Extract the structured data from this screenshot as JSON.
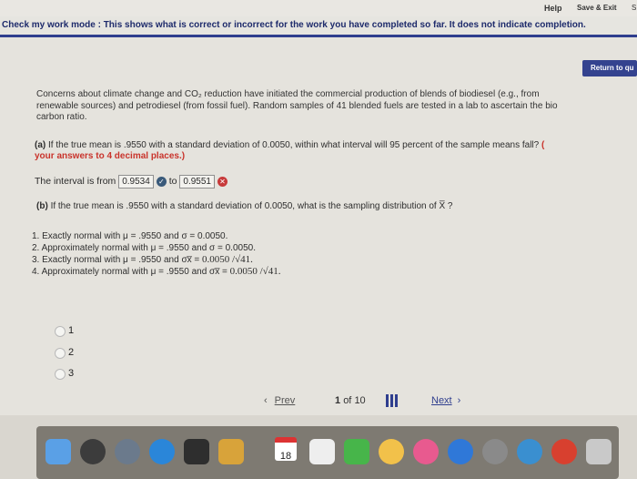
{
  "header": {
    "help_label": "Help",
    "save_exit_label": "Save & Exit",
    "cut_label": "S"
  },
  "mode_banner": "Check my work mode : This shows what is correct or incorrect for the work you have completed so far. It does not indicate completion.",
  "return_button": "Return to qu",
  "intro_line1": "Concerns about climate change and CO₂ reduction have initiated the commercial production of blends of biodiesel (e.g., from",
  "intro_line2": "renewable sources) and petrodiesel (from fossil fuel). Random samples of 41 blended fuels are tested in a lab to ascertain the bio",
  "intro_line3": "carbon ratio.",
  "part_a": {
    "label": "(a)",
    "text": "If the true mean is .9550 with a standard deviation of 0.0050, within what interval will 95 percent of the sample means fall?",
    "red_open": "(",
    "red_line": "your answers to 4 decimal places.)"
  },
  "interval": {
    "prefix": "The interval is from",
    "low": "0.9534",
    "mid": "to",
    "high": "0.9551"
  },
  "part_b": {
    "label": "(b)",
    "text": "If the true mean is .9550 with a standard deviation of 0.0050, what is the sampling distribution of X̅ ?"
  },
  "options": [
    {
      "left": "1. Exactly normal with μ = .9550 and σ = 0.0050.",
      "right": ""
    },
    {
      "left": "2. Approximately normal with μ = .9550 and σ = 0.0050.",
      "right": ""
    },
    {
      "left": "3. Exactly normal with μ = .9550 and σx̅ = ",
      "right": "0.0050 /√41."
    },
    {
      "left": "4. Approximately normal with μ = .9550 and σx̅ = ",
      "right": "0.0050 /√41."
    }
  ],
  "radios": [
    "1",
    "2",
    "3"
  ],
  "navigation": {
    "prev": "Prev",
    "page_current": "1",
    "of": "of",
    "page_total": "10",
    "next": "Next"
  },
  "dock": {
    "calendar_day": "18"
  }
}
